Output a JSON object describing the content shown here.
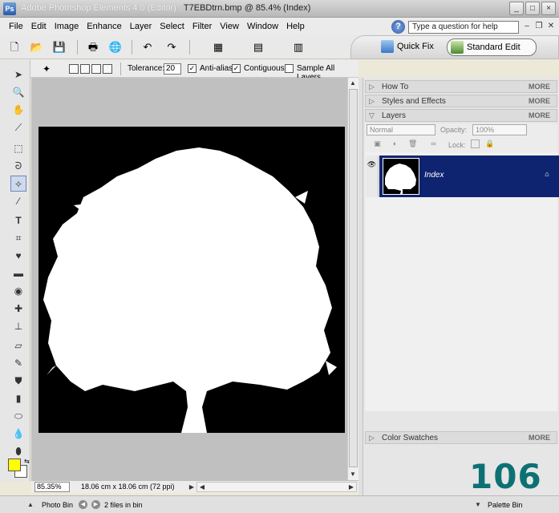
{
  "window": {
    "app_title": "Adobe Photoshop Elements 4.0 (Editor)",
    "doc_title": "T7EBDtrn.bmp @ 85.4% (Index)"
  },
  "menu": [
    "File",
    "Edit",
    "Image",
    "Enhance",
    "Layer",
    "Select",
    "Filter",
    "View",
    "Window",
    "Help"
  ],
  "help_search": {
    "placeholder": "Type a question for help"
  },
  "modes": {
    "quick_fix": "Quick Fix",
    "standard_edit": "Standard Edit"
  },
  "options": {
    "tolerance_label": "Tolerance:",
    "tolerance_value": "20",
    "anti_alias": "Anti-alias",
    "contiguous": "Contiguous",
    "sample_all_layers": "Sample All Layers"
  },
  "status": {
    "zoom": "85.35%",
    "doc_info": "18.06 cm x 18.06 cm (72 ppi)"
  },
  "palettes": {
    "how_to": "How To",
    "styles_effects": "Styles and Effects",
    "layers": "Layers",
    "color_swatches": "Color Swatches",
    "more": "MORE"
  },
  "layers_panel": {
    "blend_mode": "Normal",
    "opacity_label": "Opacity:",
    "opacity_value": "100%",
    "lock_label": "Lock:",
    "layer_name": "Index"
  },
  "bottom": {
    "photo_bin": "Photo Bin",
    "files_in_bin": "2 files in bin",
    "palette_bin": "Palette Bin"
  },
  "watermark_number": "106",
  "colors": {
    "foreground": "#ffff00",
    "background": "#ffffff",
    "layer_selected": "#0f2470"
  }
}
